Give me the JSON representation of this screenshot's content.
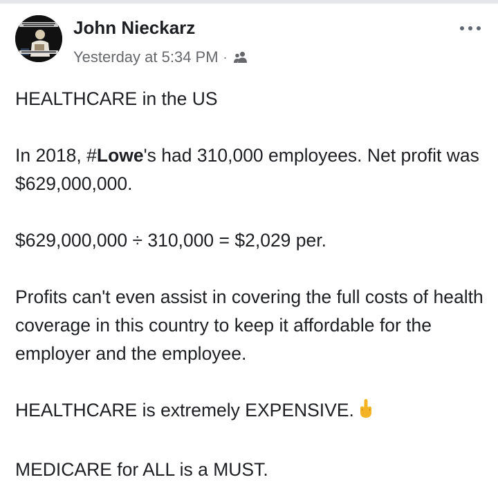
{
  "post": {
    "author_name": "John Nieckarz",
    "timestamp": "Yesterday at 5:34 PM",
    "separator": "·",
    "audience_icon": "friends-icon",
    "more_icon": "more-options-icon",
    "avatar_icon": "profile-picture"
  },
  "body": {
    "p1": "HEALTHCARE in the US",
    "p2_pre": "In 2018, ",
    "p2_hash": "#",
    "p2_hash_word": "Lowe",
    "p2_post": "'s had 310,000 employees. Net profit was $629,000,000.",
    "p3": "$629,000,000 ÷ 310,000 = $2,029 per.",
    "p4": "Profits can't even assist in covering the full costs of health coverage in this country to keep it affordable for the employer and the employee.",
    "p5": "HEALTHCARE is extremely EXPENSIVE.",
    "p5_emoji": "middle-finger-emoji",
    "p6": "MEDICARE for ALL is a MUST."
  },
  "colors": {
    "text": "#1c1e21",
    "secondary": "#65676b",
    "emoji": "#f4b322"
  }
}
